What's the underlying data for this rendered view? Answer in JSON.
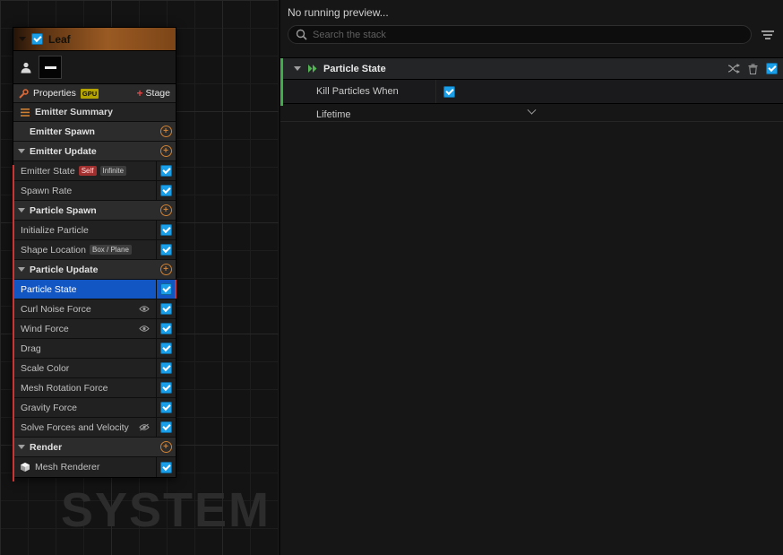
{
  "colors": {
    "accent": "#1a9ee8",
    "selection": "#1256c4",
    "group-orange": "#cf8033",
    "stack-green": "#3fae4a",
    "warn-red": "#c93434",
    "header-orange": "#9a5a23"
  },
  "canvas": {
    "watermark": "SYSTEM"
  },
  "node": {
    "title": "Leaf",
    "properties_label": "Properties",
    "gpu_badge": "GPU",
    "stage_label": "Stage",
    "summary_label": "Emitter Summary",
    "rows": [
      {
        "label": "Emitter Spawn"
      },
      {
        "label": "Emitter Update"
      },
      {
        "label": "Emitter State",
        "badges": [
          "Self",
          "Infinite"
        ]
      },
      {
        "label": "Spawn Rate"
      },
      {
        "label": "Particle Spawn"
      },
      {
        "label": "Initialize Particle"
      },
      {
        "label": "Shape Location",
        "badges": [
          "Box / Plane"
        ]
      },
      {
        "label": "Particle Update"
      },
      {
        "label": "Particle State",
        "selected": true
      },
      {
        "label": "Curl Noise Force"
      },
      {
        "label": "Wind Force"
      },
      {
        "label": "Drag"
      },
      {
        "label": "Scale Color"
      },
      {
        "label": "Mesh Rotation Force"
      },
      {
        "label": "Gravity Force"
      },
      {
        "label": "Solve Forces and Velocity"
      },
      {
        "label": "Render"
      },
      {
        "label": "Mesh Renderer"
      }
    ]
  },
  "right_panel": {
    "preview_status": "No running preview...",
    "search_placeholder": "Search the stack",
    "stack": {
      "title": "Particle State",
      "rows": [
        {
          "label": "Kill Particles When Lifetime",
          "checked": true
        }
      ]
    }
  }
}
